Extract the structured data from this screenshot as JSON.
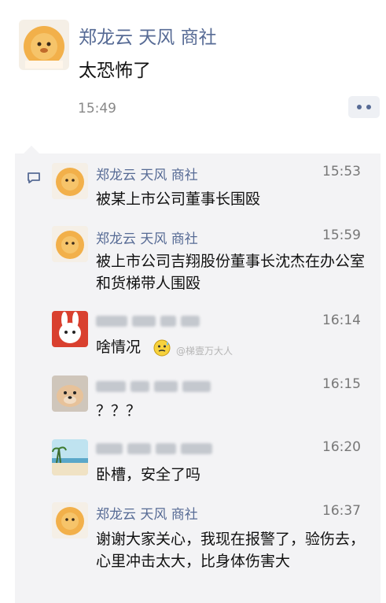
{
  "post": {
    "author": "郑龙云 天风 商社",
    "text": "太恐怖了",
    "time": "15:49"
  },
  "comments": [
    {
      "name": "郑龙云 天风 商社",
      "time": "15:53",
      "text": "被某上市公司董事长围殴"
    },
    {
      "name": "郑龙云 天风 商社",
      "time": "15:59",
      "text": "被上市公司吉翔股份董事长沈杰在办公室和货梯带人围殴"
    },
    {
      "name": "",
      "time": "16:14",
      "text": "啥情况"
    },
    {
      "name": "",
      "time": "16:15",
      "text": "？？？"
    },
    {
      "name": "",
      "time": "16:20",
      "text": "卧槽，安全了吗"
    },
    {
      "name": "郑龙云 天风 商社",
      "time": "16:37",
      "text": "谢谢大家关心，我现在报警了，验伤去，心里冲击太大，比身体伤害大"
    }
  ],
  "watermark": "@梯壹万大人",
  "icons": {
    "more": "more-dots-icon",
    "comment": "comment-icon",
    "emoji": "sweat-emoji-icon"
  },
  "colors": {
    "name": "#576b95",
    "panel": "#f3f3f5"
  }
}
